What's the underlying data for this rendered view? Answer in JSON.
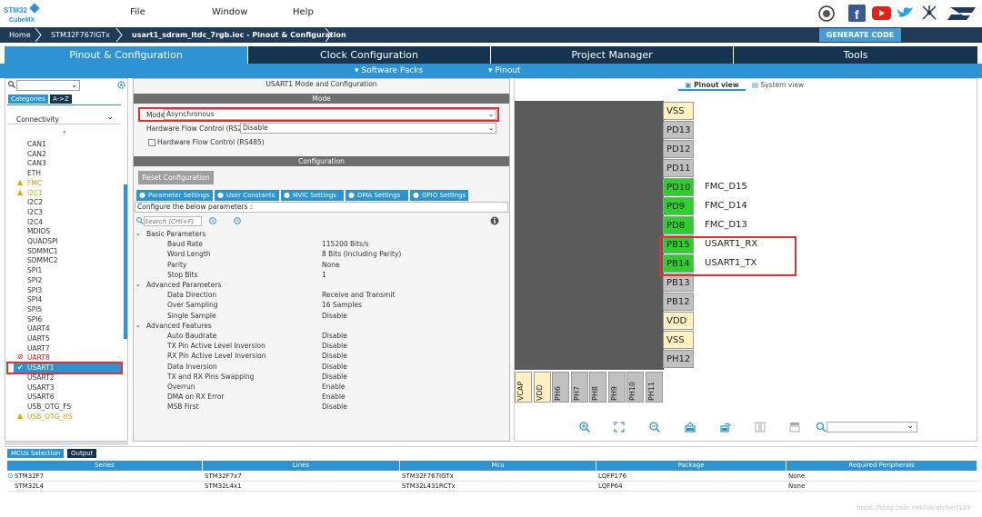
{
  "app": {
    "logo_top": "STM32",
    "logo_bottom": "CubeMX"
  },
  "menu": [
    {
      "label": "File"
    },
    {
      "label": "Window"
    },
    {
      "label": "Help"
    }
  ],
  "breadcrumb": [
    "Home",
    "STM32F767IGTx",
    "usart1_sdram_ltdc_7rgb.ioc - Pinout & Configuration"
  ],
  "generate_label": "GENERATE CODE",
  "tabs": [
    {
      "label": "Pinout & Configuration"
    },
    {
      "label": "Clock Configuration"
    },
    {
      "label": "Project Manager"
    },
    {
      "label": "Tools"
    }
  ],
  "subnav": {
    "software_packs": "Software Packs",
    "pinout": "Pinout"
  },
  "left": {
    "tab_categories": "Categories",
    "tab_az": "A->Z",
    "category": "Connectivity",
    "items": [
      {
        "label": "CAN1",
        "status": "none"
      },
      {
        "label": "CAN2",
        "status": "none"
      },
      {
        "label": "CAN3",
        "status": "none"
      },
      {
        "label": "ETH",
        "status": "none"
      },
      {
        "label": "FMC",
        "status": "warn"
      },
      {
        "label": "I2C1",
        "status": "warn"
      },
      {
        "label": "I2C2",
        "status": "none"
      },
      {
        "label": "I2C3",
        "status": "none"
      },
      {
        "label": "I2C4",
        "status": "none"
      },
      {
        "label": "MDIOS",
        "status": "none"
      },
      {
        "label": "QUADSPI",
        "status": "none"
      },
      {
        "label": "SDMMC1",
        "status": "none"
      },
      {
        "label": "SDMMC2",
        "status": "none"
      },
      {
        "label": "SPI1",
        "status": "none"
      },
      {
        "label": "SPI2",
        "status": "none"
      },
      {
        "label": "SPI3",
        "status": "none"
      },
      {
        "label": "SPI4",
        "status": "none"
      },
      {
        "label": "SPI5",
        "status": "none"
      },
      {
        "label": "SPI6",
        "status": "none"
      },
      {
        "label": "UART4",
        "status": "none"
      },
      {
        "label": "UART5",
        "status": "none"
      },
      {
        "label": "UART7",
        "status": "none"
      },
      {
        "label": "UART8",
        "status": "error"
      },
      {
        "label": "USART1",
        "status": "ok"
      },
      {
        "label": "USART2",
        "status": "none"
      },
      {
        "label": "USART3",
        "status": "none"
      },
      {
        "label": "USART6",
        "status": "none"
      },
      {
        "label": "USB_OTG_FS",
        "status": "none"
      },
      {
        "label": "USB_OTG_HS",
        "status": "warn"
      }
    ]
  },
  "center": {
    "title": "USART1 Mode and Configuration",
    "mode_header": "Mode",
    "mode_label": "Mode",
    "mode_value": "Asynchronous",
    "hwflow_label": "Hardware Flow Control (RS232)",
    "hwflow_value": "Disable",
    "hwflow485_label": "Hardware Flow Control (RS485)",
    "config_header": "Configuration",
    "reset_label": "Reset Configuration",
    "config_tabs": [
      "Parameter Settings",
      "User Constants",
      "NVIC Settings",
      "DMA Settings",
      "GPIO Settings"
    ],
    "configure_text": "Configure the below parameters :",
    "search_placeholder": "Search (Crtl+F)",
    "groups": [
      {
        "name": "Basic Parameters",
        "params": [
          {
            "name": "Baud Rate",
            "value": "115200 Bits/s"
          },
          {
            "name": "Word Length",
            "value": "8 Bits (including Parity)"
          },
          {
            "name": "Parity",
            "value": "None"
          },
          {
            "name": "Stop Bits",
            "value": "1"
          }
        ]
      },
      {
        "name": "Advanced Parameters",
        "params": [
          {
            "name": "Data Direction",
            "value": "Receive and Transmit"
          },
          {
            "name": "Over Sampling",
            "value": "16 Samples"
          },
          {
            "name": "Single Sample",
            "value": "Disable"
          }
        ]
      },
      {
        "name": "Advanced Features",
        "params": [
          {
            "name": "Auto Baudrate",
            "value": "Disable"
          },
          {
            "name": "TX Pin Active Level Inversion",
            "value": "Disable"
          },
          {
            "name": "RX Pin Active Level Inversion",
            "value": "Disable"
          },
          {
            "name": "Data Inversion",
            "value": "Disable"
          },
          {
            "name": "TX and RX Pins Swapping",
            "value": "Disable"
          },
          {
            "name": "Overrun",
            "value": "Enable"
          },
          {
            "name": "DMA on RX Error",
            "value": "Enable"
          },
          {
            "name": "MSB First",
            "value": "Disable"
          }
        ]
      }
    ]
  },
  "right": {
    "pinout_view": "Pinout view",
    "system_view": "System view",
    "pins": [
      {
        "name": "VSS",
        "kind": "y",
        "label": ""
      },
      {
        "name": "PD13",
        "kind": "gray",
        "label": ""
      },
      {
        "name": "PD12",
        "kind": "gray",
        "label": ""
      },
      {
        "name": "PD11",
        "kind": "gray",
        "label": ""
      },
      {
        "name": "PD10",
        "kind": "g",
        "label": "FMC_D15"
      },
      {
        "name": "PD9",
        "kind": "g",
        "label": "FMC_D14"
      },
      {
        "name": "PD8",
        "kind": "g",
        "label": "FMC_D13"
      },
      {
        "name": "PB15",
        "kind": "g",
        "label": "USART1_RX"
      },
      {
        "name": "PB14",
        "kind": "g",
        "label": "USART1_TX"
      },
      {
        "name": "PB13",
        "kind": "gray",
        "label": ""
      },
      {
        "name": "PB12",
        "kind": "gray",
        "label": ""
      },
      {
        "name": "VDD",
        "kind": "y",
        "label": ""
      },
      {
        "name": "VSS",
        "kind": "y",
        "label": ""
      },
      {
        "name": "PH12",
        "kind": "gray",
        "label": ""
      }
    ],
    "bottom_pins": [
      {
        "name": "VCAP",
        "kind": "y"
      },
      {
        "name": "VDD",
        "kind": "y"
      },
      {
        "name": "PH6",
        "kind": "gray"
      },
      {
        "name": "PH7",
        "kind": "gray"
      },
      {
        "name": "PH8",
        "kind": "gray"
      },
      {
        "name": "PH9",
        "kind": "gray"
      },
      {
        "name": "PH10",
        "kind": "gray"
      },
      {
        "name": "PH11",
        "kind": "gray"
      }
    ]
  },
  "bottom": {
    "tab_mcus": "MCUs Selection",
    "tab_output": "Output",
    "columns": [
      "Series",
      "Lines",
      "Mcu",
      "Package",
      "Required Peripherals"
    ],
    "rows": [
      [
        "STM32F7",
        "STM32F7x7",
        "STM32F767IGTx",
        "LQFP176",
        "None"
      ],
      [
        "STM32L4",
        "STM32L4x1",
        "STM32L431RCTx",
        "LQFP64",
        "None"
      ]
    ]
  },
  "watermark": "https://blog.csdn.net/lokiarcher/123",
  "colors": {
    "accent": "#2d93d2",
    "dark": "#14344f",
    "pin_green": "#2ccf2c",
    "highlight": "#e03030"
  }
}
